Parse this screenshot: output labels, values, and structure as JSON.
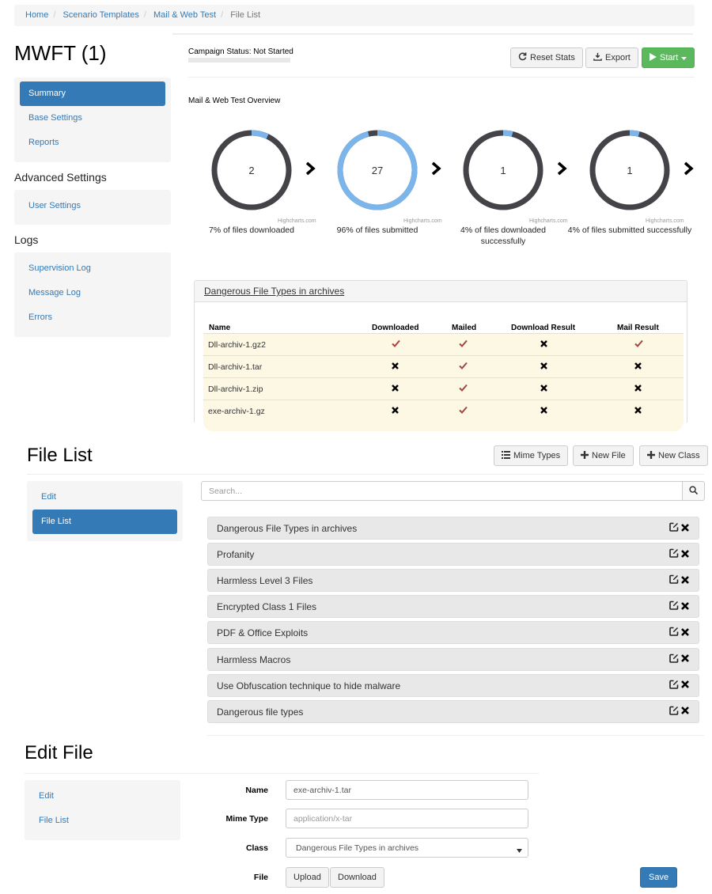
{
  "breadcrumb": [
    "Home",
    "Scenario Templates",
    "Mail & Web Test",
    "File List"
  ],
  "campaign": {
    "title": "MWFT (1)",
    "status_label": "Campaign Status:",
    "status_value": "Not Started",
    "nav": {
      "items": [
        "Summary",
        "Base Settings",
        "Reports"
      ],
      "active": "Summary",
      "advanced_heading": "Advanced Settings",
      "advanced_items": [
        "User Settings"
      ],
      "logs_heading": "Logs",
      "logs_items": [
        "Supervision Log",
        "Message Log",
        "Errors"
      ]
    },
    "buttons": {
      "reset": "Reset Stats",
      "export": "Export",
      "start": "Start"
    },
    "overview_title": "Mail & Web Test Overview",
    "credit": "Highcharts.com",
    "colors": {
      "accent": "#7cb5ec",
      "dark": "#434348",
      "primary": "#337ab7",
      "success": "#5cb85c"
    }
  },
  "chart_data": [
    {
      "type": "pie",
      "value_label": "2",
      "percent": 7,
      "caption": "7% of files downloaded"
    },
    {
      "type": "pie",
      "value_label": "27",
      "percent": 96,
      "caption": "96% of files submitted"
    },
    {
      "type": "pie",
      "value_label": "1",
      "percent": 4,
      "caption": "4% of files downloaded successfully"
    },
    {
      "type": "pie",
      "value_label": "1",
      "percent": 4,
      "caption": "4% of files submitted successfully"
    }
  ],
  "dangerous_panel": {
    "title": "Dangerous File Types in archives",
    "columns": [
      "Name",
      "Downloaded",
      "Mailed",
      "Download Result",
      "Mail Result"
    ],
    "rows": [
      {
        "name": "Dll-archiv-1.gz2",
        "downloaded": true,
        "mailed": true,
        "download_result": false,
        "mail_result": true
      },
      {
        "name": "Dll-archiv-1.tar",
        "downloaded": false,
        "mailed": true,
        "download_result": false,
        "mail_result": false
      },
      {
        "name": "Dll-archiv-1.zip",
        "downloaded": false,
        "mailed": true,
        "download_result": false,
        "mail_result": false
      },
      {
        "name": "exe-archiv-1.gz",
        "downloaded": false,
        "mailed": true,
        "download_result": false,
        "mail_result": false
      }
    ]
  },
  "file_list": {
    "title": "File List",
    "buttons": {
      "mime": "Mime Types",
      "new_file": "New File",
      "new_class": "New Class"
    },
    "nav": [
      "Edit",
      "File List"
    ],
    "nav_active": "File List",
    "search_placeholder": "Search...",
    "items": [
      "Dangerous File Types in archives",
      "Profanity",
      "Harmless Level 3 Files",
      "Encrypted Class 1 Files",
      "PDF & Office Exploits",
      "Harmless Macros",
      "Use Obfuscation technique to hide malware",
      "Dangerous file types"
    ]
  },
  "edit_file": {
    "title": "Edit File",
    "nav": [
      "Edit",
      "File List"
    ],
    "labels": {
      "name": "Name",
      "mime": "Mime Type",
      "class": "Class",
      "file": "File"
    },
    "name_value": "exe-archiv-1.tar",
    "mime_placeholder": "application/x-tar",
    "class_value": "Dangerous File Types in archives",
    "buttons": {
      "upload": "Upload",
      "download": "Download",
      "save": "Save"
    }
  }
}
